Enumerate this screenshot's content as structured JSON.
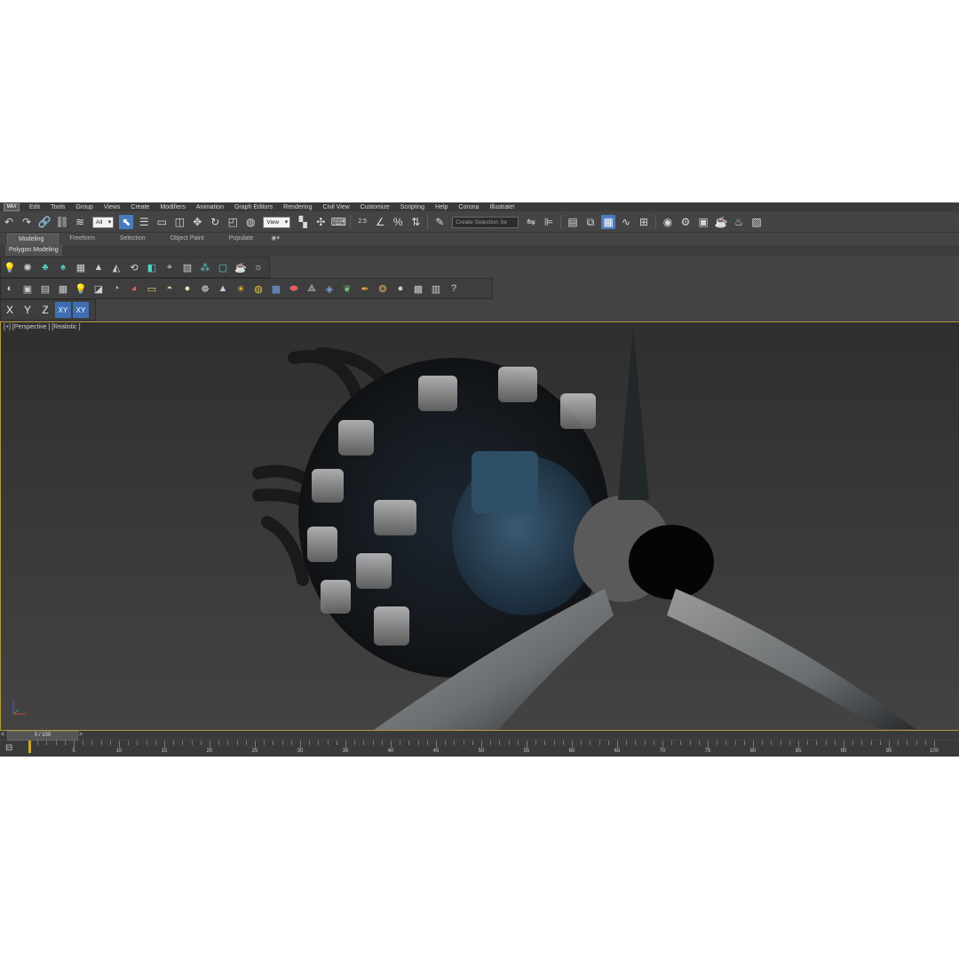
{
  "menu": {
    "logo": "MAX",
    "items": [
      "Edit",
      "Tools",
      "Group",
      "Views",
      "Create",
      "Modifiers",
      "Animation",
      "Graph Editors",
      "Rendering",
      "Civil View",
      "Customize",
      "Scripting",
      "Help",
      "Corona",
      "Illustrate!"
    ]
  },
  "toolbar": {
    "selection_filter": "All",
    "reference_coord": "View",
    "snap_label": "2.5",
    "named_selection_placeholder": "Create Selection Se"
  },
  "ribbon": {
    "tabs": [
      "Modeling",
      "Freeform",
      "Selection",
      "Object Paint",
      "Populate"
    ],
    "active_tab": "Modeling",
    "panel_label": "Polygon Modeling"
  },
  "axis_constraints": {
    "x": "X",
    "y": "Y",
    "z": "Z",
    "xy": "XY",
    "xy2": "XY"
  },
  "viewport": {
    "label": "[+] [Perspective ] [Realistic ]"
  },
  "timeline": {
    "frame_display": "0 / 100",
    "prev_arrow": "<",
    "next_arrow": ">",
    "ticks": [
      "5",
      "10",
      "15",
      "20",
      "25",
      "30",
      "35",
      "40",
      "45",
      "50",
      "55",
      "60",
      "65",
      "70",
      "75",
      "80",
      "85",
      "90",
      "95",
      "100"
    ]
  },
  "colors": {
    "accent": "#4a7dbf",
    "viewport_border": "#b59a3a",
    "ui_bg": "#444444"
  }
}
